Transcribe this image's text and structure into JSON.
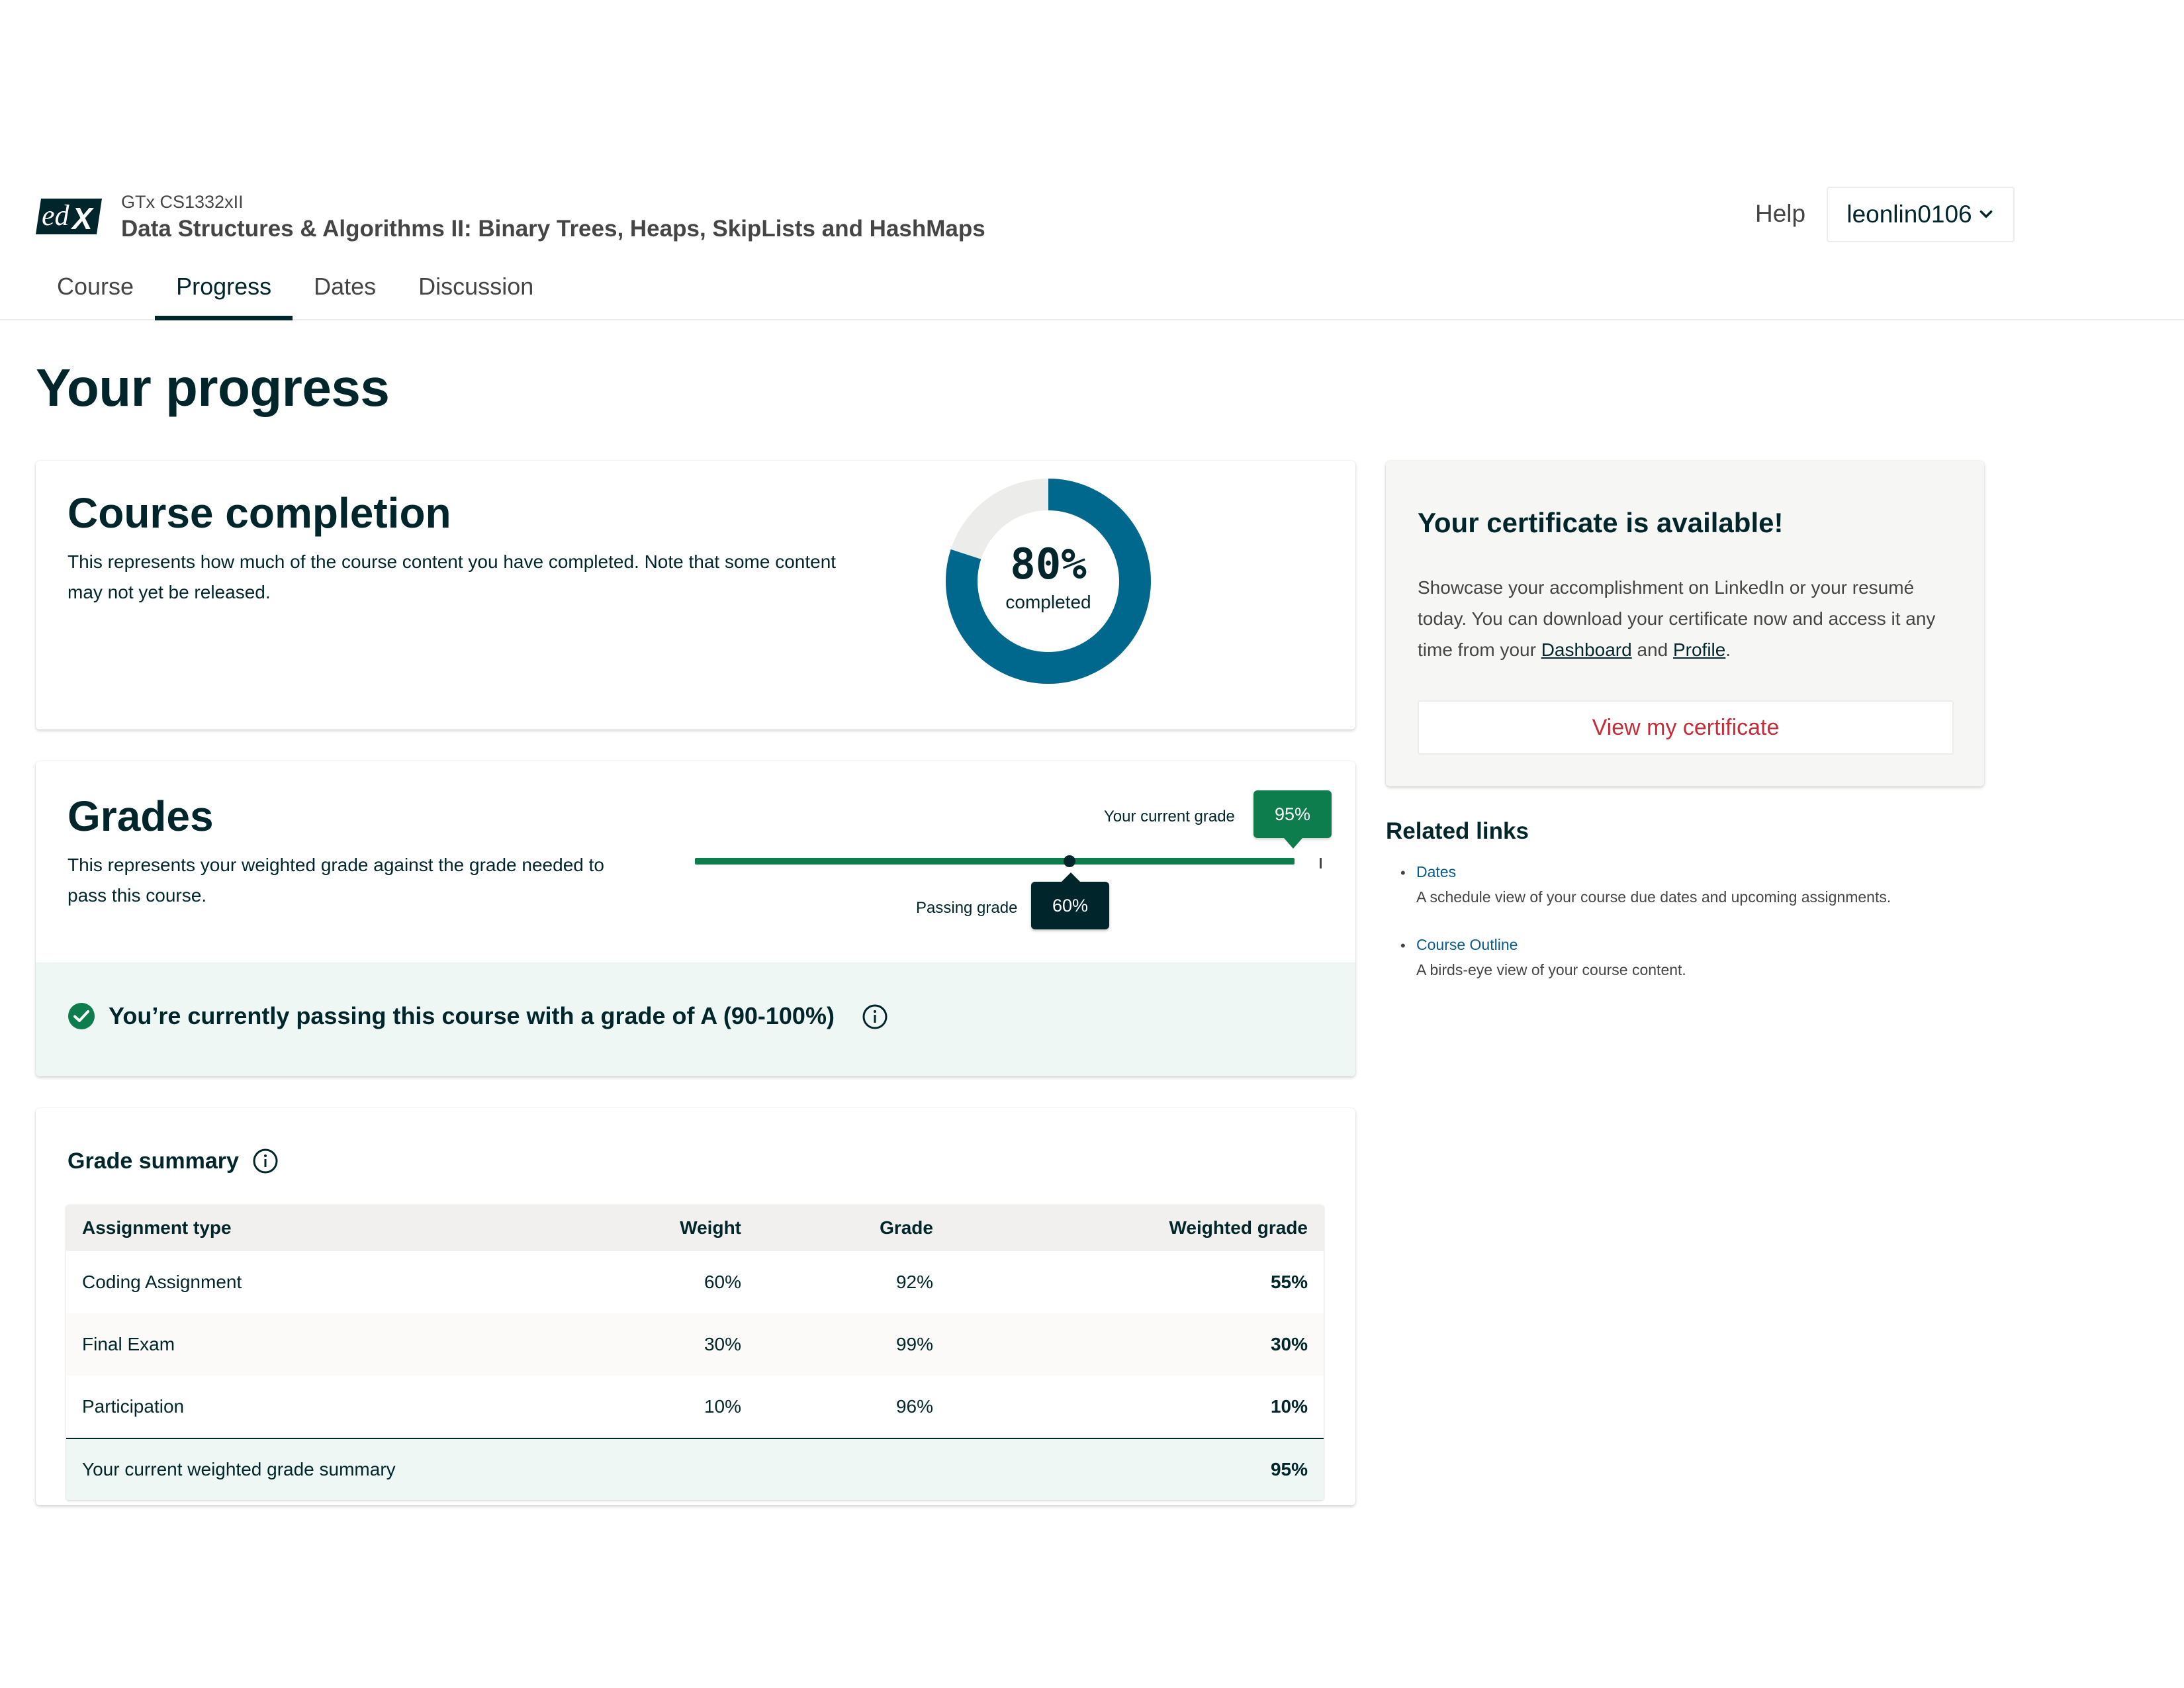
{
  "header": {
    "course_org": "GTx CS1332xII",
    "course_title": "Data Structures & Algorithms II: Binary Trees, Heaps, SkipLists and HashMaps",
    "help_label": "Help",
    "username": "leonlin0106",
    "logo_text": "edX"
  },
  "tabs": [
    {
      "label": "Course",
      "active": false
    },
    {
      "label": "Progress",
      "active": true
    },
    {
      "label": "Dates",
      "active": false
    },
    {
      "label": "Discussion",
      "active": false
    }
  ],
  "page_title": "Your progress",
  "completion": {
    "title": "Course completion",
    "description": "This represents how much of the course content you have completed. Note that some content may not yet be released.",
    "percent_label": "80%",
    "percent_value": 0.8,
    "caption": "completed",
    "colors": {
      "complete": "#00688d",
      "incomplete": "#ececea"
    }
  },
  "grades": {
    "title": "Grades",
    "description": "This represents your weighted grade against the grade needed to pass this course.",
    "current_label": "Your current grade",
    "current_value": "95%",
    "current_fraction": 0.95,
    "passing_label": "Passing grade",
    "passing_value": "60%",
    "passing_fraction": 0.6,
    "pass_message": "You’re currently passing this course with a grade of A (90-100%)",
    "colors": {
      "bar": "#0d7d4d",
      "passing_tooltip": "#00262b",
      "banner": "#eef7f4"
    }
  },
  "summary": {
    "title": "Grade summary",
    "headers": {
      "type": "Assignment type",
      "weight": "Weight",
      "grade": "Grade",
      "weighted": "Weighted grade"
    },
    "rows": [
      {
        "type": "Coding Assignment",
        "weight": "60%",
        "grade": "92%",
        "weighted": "55%"
      },
      {
        "type": "Final Exam",
        "weight": "30%",
        "grade": "99%",
        "weighted": "30%"
      },
      {
        "type": "Participation",
        "weight": "10%",
        "grade": "96%",
        "weighted": "10%"
      }
    ],
    "total_label": "Your current weighted grade summary",
    "total_value": "95%"
  },
  "certificate": {
    "title": "Your certificate is available!",
    "desc_part1": "Showcase your accomplishment on LinkedIn or your resumé today. You can download your certificate now and access it any time from your ",
    "dashboard_link": "Dashboard",
    "desc_and": " and ",
    "profile_link": "Profile",
    "desc_end": ".",
    "button_label": "View my certificate",
    "button_color": "#c32d3a"
  },
  "related": {
    "title": "Related links",
    "items": [
      {
        "label": "Dates",
        "description": "A schedule view of your course due dates and upcoming assignments."
      },
      {
        "label": "Course Outline",
        "description": "A birds-eye view of your course content."
      }
    ]
  },
  "icons": {
    "chevron": "chevron-down-icon",
    "check": "check-circle-icon",
    "info": "info-outline-icon"
  }
}
